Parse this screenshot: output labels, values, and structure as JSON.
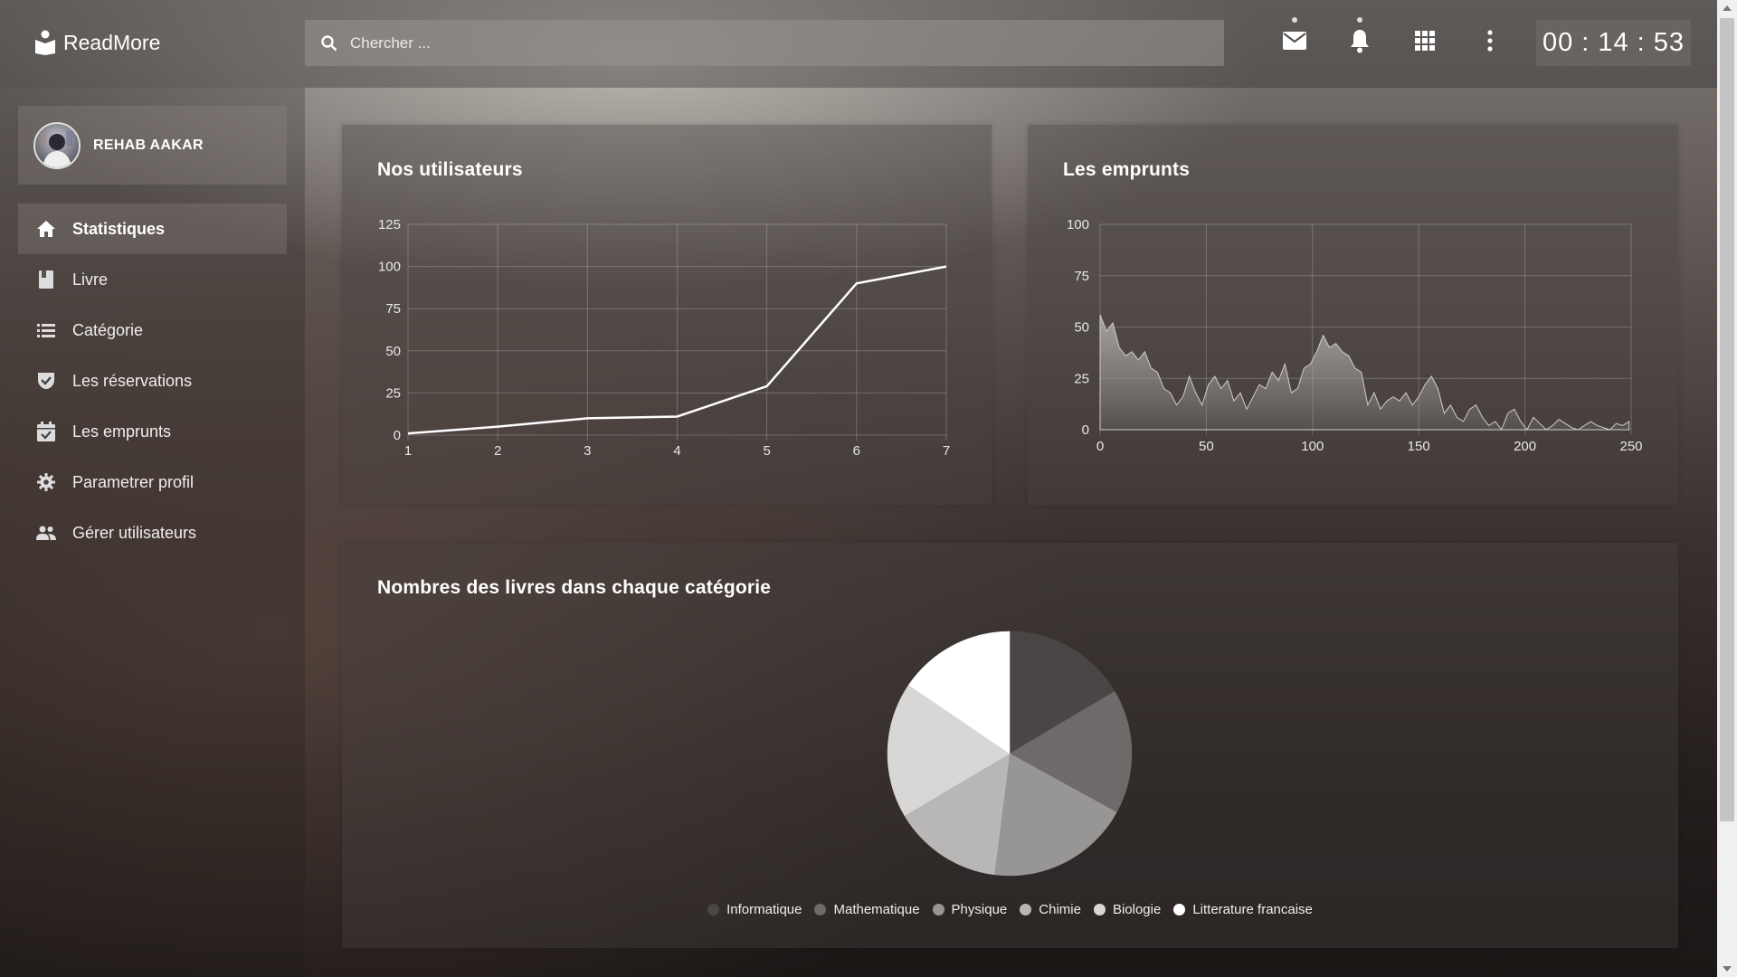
{
  "brand": {
    "name": "ReadMore",
    "logo_icon": "book-reader-icon"
  },
  "search": {
    "placeholder": "Chercher ..."
  },
  "top_icons": [
    {
      "name": "mail-icon",
      "badge": true
    },
    {
      "name": "bell-icon",
      "badge": true
    },
    {
      "name": "apps-grid-icon",
      "badge": false
    },
    {
      "name": "more-vertical-icon",
      "badge": false
    }
  ],
  "clock": "00 : 14 : 53",
  "profile": {
    "username": "REHAB AAKAR"
  },
  "sidebar": {
    "items": [
      {
        "label": "Statistiques",
        "icon": "home-icon",
        "active": true
      },
      {
        "label": "Livre",
        "icon": "book-icon",
        "active": false
      },
      {
        "label": "Catégorie",
        "icon": "list-icon",
        "active": false
      },
      {
        "label": "Les réservations",
        "icon": "shield-check-icon",
        "active": false
      },
      {
        "label": "Les emprunts",
        "icon": "calendar-check-icon",
        "active": false
      },
      {
        "label": "Parametrer profil",
        "icon": "gear-icon",
        "active": false
      },
      {
        "label": "Gérer utilisateurs",
        "icon": "users-icon",
        "active": false
      }
    ]
  },
  "cards": {
    "users": {
      "title": "Nos utilisateurs"
    },
    "loans": {
      "title": "Les emprunts"
    },
    "categories": {
      "title": "Nombres des livres dans chaque catégorie"
    }
  },
  "colors": {
    "line": "#ffffff",
    "grid": "rgba(255,255,255,0.22)",
    "area_fill": "#a9a6a3"
  },
  "chart_data": [
    {
      "type": "line",
      "title": "Nos utilisateurs",
      "x": [
        1,
        2,
        3,
        4,
        5,
        6,
        7
      ],
      "values": [
        1,
        5,
        10,
        11,
        29,
        90,
        100
      ],
      "xticks": [
        "1",
        "2",
        "3",
        "4",
        "5",
        "6",
        "7"
      ],
      "yticks": [
        "0",
        "25",
        "50",
        "75",
        "100",
        "125"
      ],
      "ylim": [
        0,
        125
      ],
      "grid": true
    },
    {
      "type": "area",
      "title": "Les emprunts",
      "xlim": [
        0,
        250
      ],
      "ylim": [
        0,
        100
      ],
      "xticks": [
        "0",
        "50",
        "100",
        "150",
        "200",
        "250"
      ],
      "yticks": [
        "0",
        "25",
        "50",
        "75",
        "100"
      ],
      "grid": true,
      "x": [
        0,
        3,
        6,
        9,
        12,
        15,
        18,
        21,
        24,
        27,
        30,
        33,
        36,
        39,
        42,
        45,
        48,
        51,
        54,
        57,
        60,
        63,
        66,
        69,
        72,
        75,
        78,
        81,
        84,
        87,
        90,
        93,
        96,
        99,
        102,
        105,
        108,
        111,
        114,
        117,
        120,
        123,
        126,
        129,
        132,
        135,
        138,
        141,
        144,
        147,
        150,
        153,
        156,
        159,
        162,
        165,
        168,
        171,
        174,
        177,
        180,
        183,
        186,
        189,
        192,
        195,
        198,
        201,
        204,
        207,
        210,
        213,
        216,
        219,
        222,
        225,
        228,
        231,
        234,
        237,
        240,
        243,
        246,
        249
      ],
      "values": [
        56,
        48,
        52,
        40,
        36,
        38,
        34,
        38,
        30,
        28,
        20,
        18,
        12,
        16,
        26,
        18,
        12,
        22,
        26,
        20,
        24,
        14,
        18,
        10,
        16,
        22,
        20,
        28,
        24,
        32,
        18,
        20,
        30,
        32,
        38,
        46,
        40,
        42,
        38,
        36,
        30,
        28,
        12,
        18,
        10,
        14,
        16,
        14,
        18,
        12,
        16,
        22,
        26,
        20,
        8,
        12,
        6,
        4,
        10,
        12,
        6,
        2,
        4,
        0,
        8,
        10,
        4,
        0,
        6,
        3,
        0,
        2,
        5,
        3,
        1,
        0,
        2,
        4,
        2,
        1,
        0,
        3,
        2,
        4
      ]
    },
    {
      "type": "pie",
      "title": "Nombres des livres dans chaque catégorie",
      "categories": [
        "Informatique",
        "Mathematique",
        "Physique",
        "Chimie",
        "Biologie",
        "Litterature francaise"
      ],
      "values": [
        16.5,
        16.5,
        19,
        14.5,
        18,
        15.5
      ],
      "colors": [
        "#4a4645",
        "#6d6a69",
        "#989595",
        "#b9b7b6",
        "#d8d7d6",
        "#ffffff"
      ],
      "legend": "bottom"
    }
  ]
}
